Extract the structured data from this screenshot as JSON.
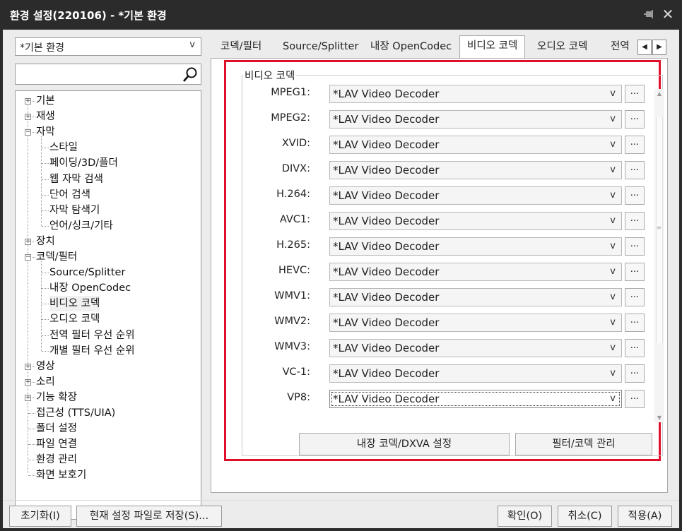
{
  "window": {
    "title": "환경 설정(220106) - *기본 환경",
    "close_glyph": "✕"
  },
  "profile": {
    "selected": "*기본 환경"
  },
  "search": {
    "value": ""
  },
  "tree": [
    {
      "label": "기본",
      "box": "+",
      "level": 0
    },
    {
      "label": "재생",
      "box": "+",
      "level": 0
    },
    {
      "label": "자막",
      "box": "−",
      "level": 0
    },
    {
      "label": "스타일",
      "level": 1
    },
    {
      "label": "페이딩/3D/플더",
      "level": 1
    },
    {
      "label": "웹 자막 검색",
      "level": 1
    },
    {
      "label": "단어 검색",
      "level": 1
    },
    {
      "label": "자막 탐색기",
      "level": 1
    },
    {
      "label": "언어/싱크/기타",
      "level": 1
    },
    {
      "label": "장치",
      "box": "+",
      "level": 0
    },
    {
      "label": "코덱/필터",
      "box": "−",
      "level": 0
    },
    {
      "label": "Source/Splitter",
      "level": 1
    },
    {
      "label": "내장 OpenCodec",
      "level": 1
    },
    {
      "label": "비디오 코덱",
      "level": 1,
      "selected": true
    },
    {
      "label": "오디오 코덱",
      "level": 1
    },
    {
      "label": "전역 필터 우선 순위",
      "level": 1
    },
    {
      "label": "개별 필터 우선 순위",
      "level": 1
    },
    {
      "label": "영상",
      "box": "+",
      "level": 0
    },
    {
      "label": "소리",
      "box": "+",
      "level": 0
    },
    {
      "label": "기능 확장",
      "box": "+",
      "level": 0
    },
    {
      "label": "접근성 (TTS/UIA)",
      "level": 0
    },
    {
      "label": "폴더 설정",
      "level": 0
    },
    {
      "label": "파일 연결",
      "level": 0
    },
    {
      "label": "환경 관리",
      "level": 0
    },
    {
      "label": "화면 보호기",
      "level": 0
    }
  ],
  "tabs": [
    {
      "label": "코덱/필터",
      "active": false
    },
    {
      "label": "Source/Splitter",
      "active": false
    },
    {
      "label": "내장 OpenCodec",
      "active": false
    },
    {
      "label": "비디오 코덱",
      "active": true
    },
    {
      "label": "오디오 코덱",
      "active": false
    },
    {
      "label": "전역",
      "active": false
    }
  ],
  "group_title": "비디오 코덱",
  "codecs": [
    {
      "label": "MPEG1:",
      "value": "*LAV Video Decoder"
    },
    {
      "label": "MPEG2:",
      "value": "*LAV Video Decoder"
    },
    {
      "label": "XVID:",
      "value": "*LAV Video Decoder"
    },
    {
      "label": "DIVX:",
      "value": "*LAV Video Decoder"
    },
    {
      "label": "H.264:",
      "value": "*LAV Video Decoder"
    },
    {
      "label": "AVC1:",
      "value": "*LAV Video Decoder"
    },
    {
      "label": "H.265:",
      "value": "*LAV Video Decoder"
    },
    {
      "label": "HEVC:",
      "value": "*LAV Video Decoder"
    },
    {
      "label": "WMV1:",
      "value": "*LAV Video Decoder"
    },
    {
      "label": "WMV2:",
      "value": "*LAV Video Decoder"
    },
    {
      "label": "WMV3:",
      "value": "*LAV Video Decoder"
    },
    {
      "label": "VC-1:",
      "value": "*LAV Video Decoder"
    },
    {
      "label": "VP8:",
      "value": "*LAV Video Decoder",
      "focused": true
    }
  ],
  "more_button_label": "...",
  "dropdown_glyph": "v",
  "actions": {
    "builtin_dxva": "내장 코덱/DXVA 설정",
    "filter_manage": "필터/코덱 관리"
  },
  "bottom": {
    "reset": "초기화(I)",
    "save_as": "현재 설정 파일로 저장(S)...",
    "ok": "확인(O)",
    "cancel": "취소(C)",
    "apply": "적용(A)"
  },
  "colors": {
    "highlight_border": "#e0102a",
    "titlebar": "#2b2b2b"
  }
}
